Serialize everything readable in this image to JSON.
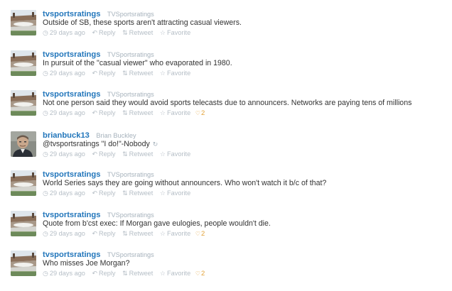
{
  "colors": {
    "link_blue": "#2276bb",
    "meta_grey": "#a6b2bc",
    "text": "#333333",
    "favorite_orange": "#e3a33a"
  },
  "icons": {
    "reply": "reply-arrow-icon",
    "retweet": "retweet-icon",
    "favorite": "star-icon",
    "timestamp": "clock-icon",
    "conversation": "conversation-icon"
  },
  "tweets": [
    {
      "screen_name": "tvsportsratings",
      "full_name": "TVSportsratings",
      "text": "Outside of SB, these sports aren't attracting casual viewers.",
      "timestamp": "29 days ago",
      "reply_label": "Reply",
      "retweet_label": "Retweet",
      "favorite_label": "Favorite",
      "favorite_count": ""
    },
    {
      "screen_name": "tvsportsratings",
      "full_name": "TVSportsratings",
      "text": "In pursuit of the \"casual viewer\" who evaporated in 1980.",
      "timestamp": "29 days ago",
      "reply_label": "Reply",
      "retweet_label": "Retweet",
      "favorite_label": "Favorite",
      "favorite_count": ""
    },
    {
      "screen_name": "tvsportsratings",
      "full_name": "TVSportsratings",
      "text": "Not one person said they would avoid sports telecasts due to announcers. Networks are paying tens of millions",
      "timestamp": "29 days ago",
      "reply_label": "Reply",
      "retweet_label": "Retweet",
      "favorite_label": "Favorite",
      "favorite_count": "2"
    },
    {
      "screen_name": "brianbuck13",
      "full_name": "Brian Buckley",
      "text": "@tvsportsratings \"I do!\"-Nobody",
      "timestamp": "29 days ago",
      "reply_label": "Reply",
      "retweet_label": "Retweet",
      "favorite_label": "Favorite",
      "favorite_count": ""
    },
    {
      "screen_name": "tvsportsratings",
      "full_name": "TVSportsratings",
      "text": "World Series says they are going without announcers. Who won't watch it b/c of that?",
      "timestamp": "29 days ago",
      "reply_label": "Reply",
      "retweet_label": "Retweet",
      "favorite_label": "Favorite",
      "favorite_count": ""
    },
    {
      "screen_name": "tvsportsratings",
      "full_name": "TVSportsratings",
      "text": "Quote from b'cst exec: If Morgan gave eulogies, people wouldn't die.",
      "timestamp": "29 days ago",
      "reply_label": "Reply",
      "retweet_label": "Retweet",
      "favorite_label": "Favorite",
      "favorite_count": "2"
    },
    {
      "screen_name": "tvsportsratings",
      "full_name": "TVSportsratings",
      "text": "Who misses Joe Morgan?",
      "timestamp": "29 days ago",
      "reply_label": "Reply",
      "retweet_label": "Retweet",
      "favorite_label": "Favorite",
      "favorite_count": "2"
    }
  ]
}
